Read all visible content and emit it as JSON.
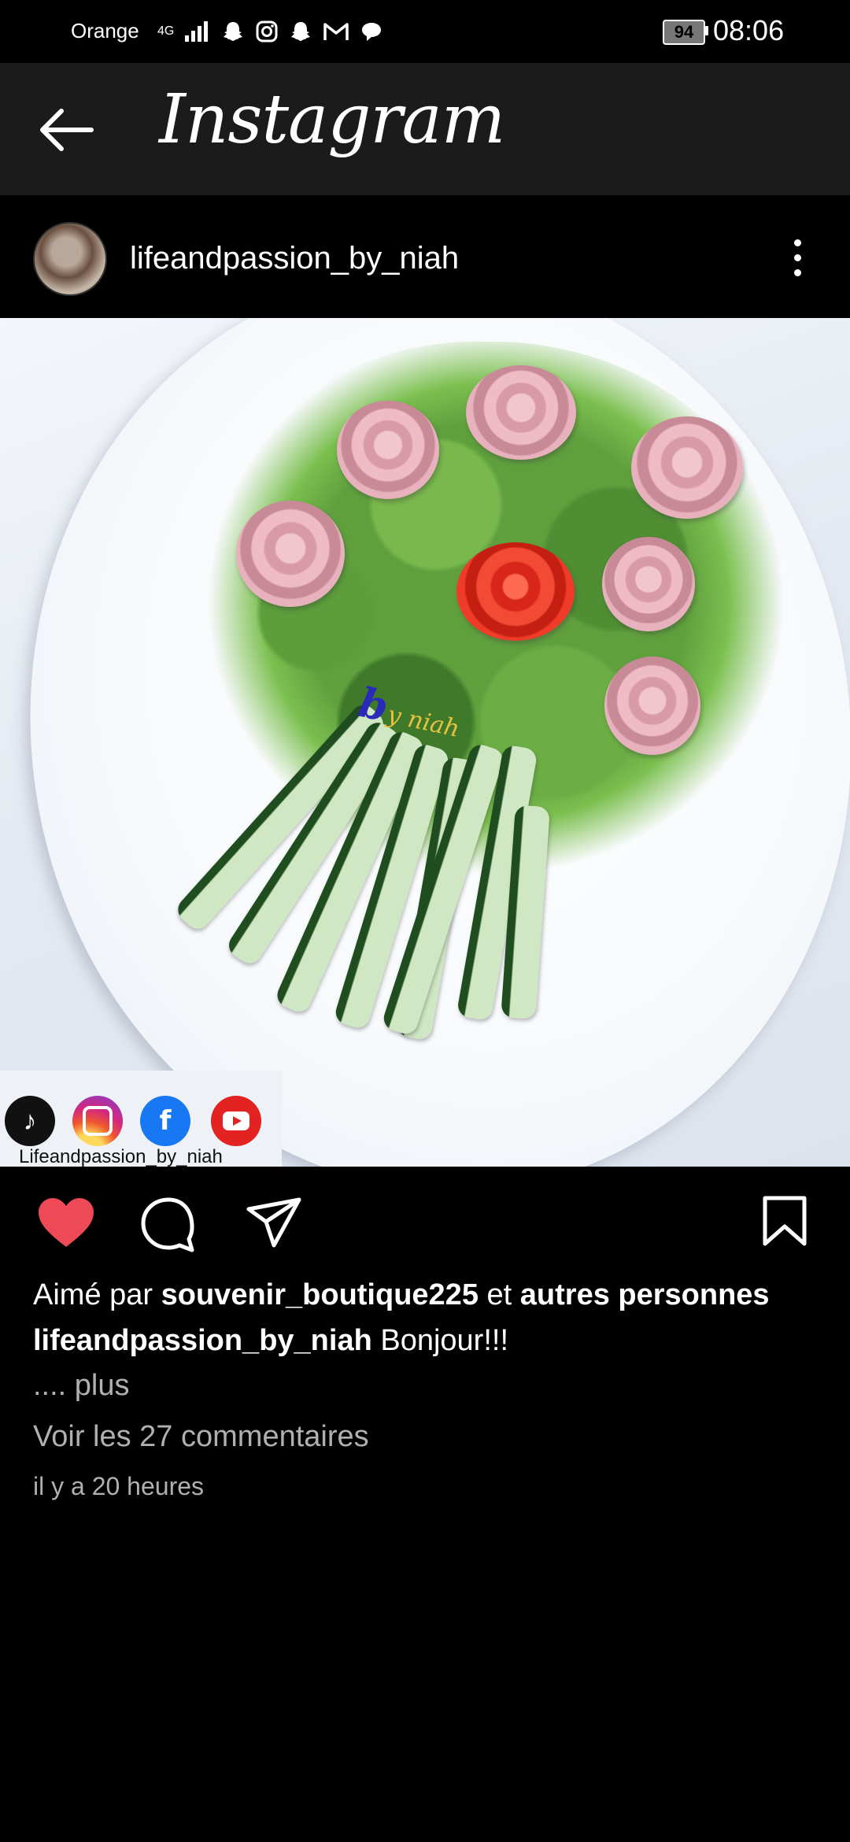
{
  "status_bar": {
    "carrier": "Orange",
    "network": "4G",
    "battery": "94",
    "time": "08:06",
    "icons": [
      "signal-icon",
      "snapchat-icon",
      "instagram-icon",
      "snapchat-icon",
      "gmail-icon",
      "chat-icon"
    ]
  },
  "app_bar": {
    "title": "Instagram",
    "back_icon": "back-arrow-icon"
  },
  "post": {
    "username": "lifeandpassion_by_niah",
    "image": {
      "watermark_letter": "b",
      "watermark_text": "y niah",
      "social_strip_label": "Lifeandpassion_by_niah",
      "social_icons": [
        "tiktok-icon",
        "instagram-icon",
        "facebook-icon",
        "youtube-icon"
      ]
    },
    "liked_by_prefix": "Aimé par",
    "liked_by_user": "souvenir_boutique225",
    "liked_by_connector": "et",
    "liked_by_others": "autres personnes",
    "caption_user": "lifeandpassion_by_niah",
    "caption_text": "Bonjour!!!",
    "more_label": ".... plus",
    "view_comments": "Voir les 27 commentaires",
    "timestamp": "il y a 20 heures"
  },
  "colors": {
    "background": "#000000",
    "app_bar": "#1b1b1b",
    "like_red": "#ed4956",
    "secondary_text": "#b0b0b0"
  }
}
